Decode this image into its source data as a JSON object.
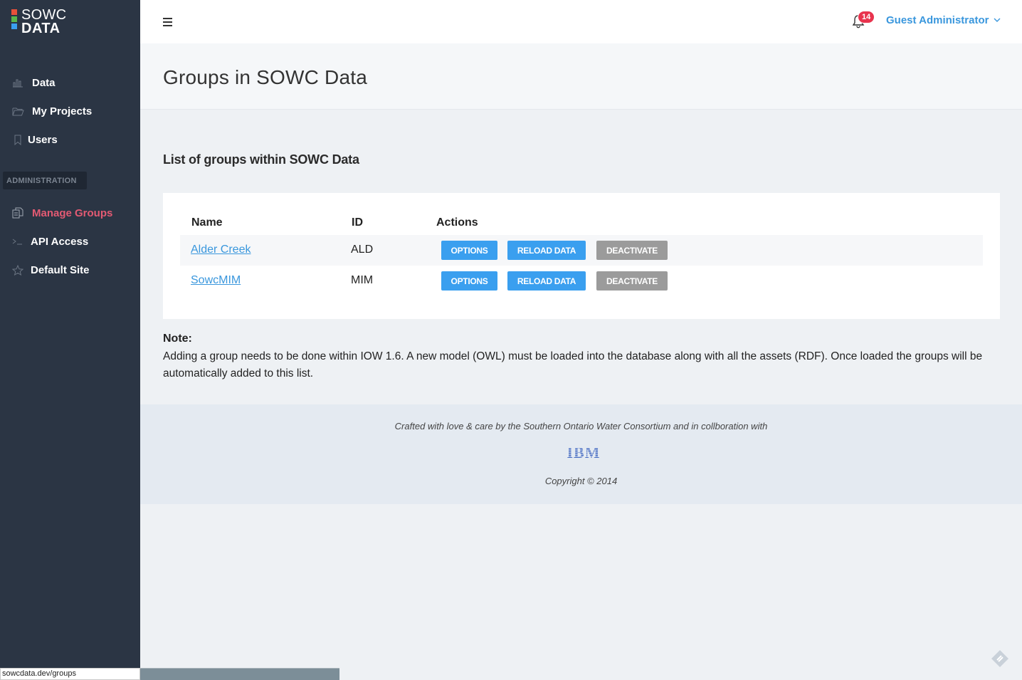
{
  "app": {
    "logo_line1": "SOWC",
    "logo_line2": "DATA",
    "logo_colors": [
      "#e8503a",
      "#59b54a",
      "#3a9fef"
    ]
  },
  "sidebar": {
    "items": [
      {
        "label": "Data",
        "icon": "bar-chart-icon"
      },
      {
        "label": "My Projects",
        "icon": "folder-icon"
      },
      {
        "label": "Users",
        "icon": "bookmark-icon"
      }
    ],
    "admin_heading": "ADMINISTRATION",
    "admin_items": [
      {
        "label": "Manage Groups",
        "icon": "copy-icon",
        "active": true
      },
      {
        "label": "API Access",
        "icon": "terminal-icon"
      },
      {
        "label": "Default Site",
        "icon": "star-icon"
      }
    ]
  },
  "topbar": {
    "notification_count": "14",
    "user_name": "Guest Administrator"
  },
  "page": {
    "title": "Groups in SOWC Data",
    "section_title": "List of groups within SOWC Data"
  },
  "table": {
    "headers": [
      "Name",
      "ID",
      "Actions"
    ],
    "rows": [
      {
        "name": "Alder Creek",
        "id": "ALD"
      },
      {
        "name": "SowcMIM",
        "id": "MIM"
      }
    ],
    "buttons": {
      "options": "OPTIONS",
      "reload": "RELOAD DATA",
      "deactivate": "DEACTIVATE"
    }
  },
  "note": {
    "title": "Note:",
    "text": "Adding a group needs to be done within IOW 1.6. A new model (OWL) must be loaded into the database along with all the assets (RDF). Once loaded the groups will be automatically added to this list."
  },
  "footer": {
    "credit": "Crafted with love & care by the Southern Ontario Water Consortium and in collboration with",
    "partner_logo": "IBM",
    "copyright": "Copyright © 2014"
  },
  "status_bar": {
    "url": "sowcdata.dev/groups"
  },
  "colors": {
    "sidebar_bg": "#2b3544",
    "accent": "#3a97dd",
    "active_nav": "#e35a73",
    "badge": "#e8344e"
  }
}
